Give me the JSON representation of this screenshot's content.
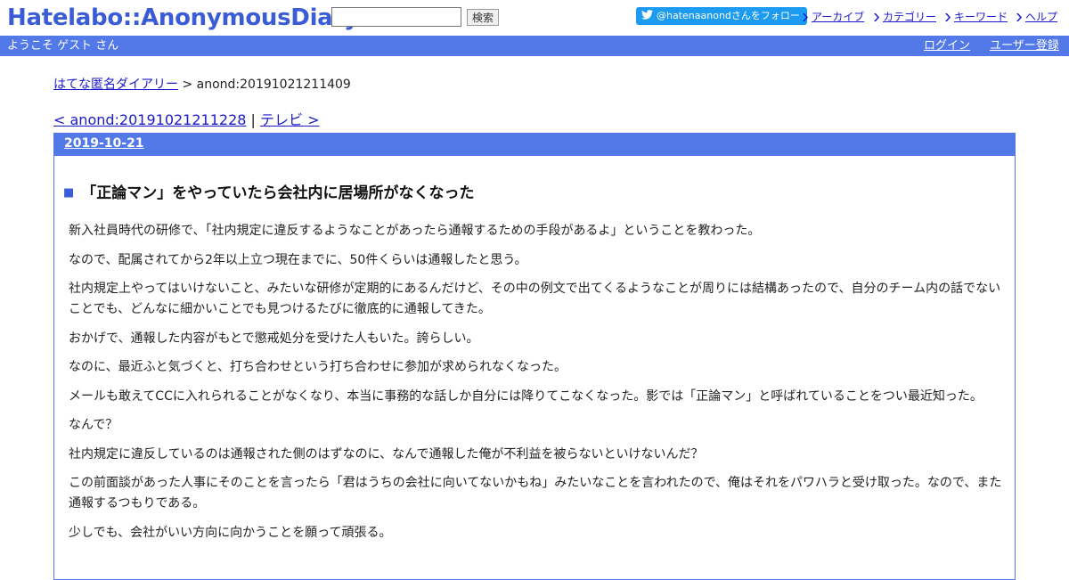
{
  "header": {
    "logo": "Hatelabo::AnonymousDiary",
    "search_button": "検索",
    "search_value": "",
    "twitter_follow": "@hatenaanondさんをフォロー",
    "nav": [
      "アーカイブ",
      "カテゴリー",
      "キーワード",
      "ヘルプ"
    ]
  },
  "topbar": {
    "welcome": "ようこそ ゲスト さん",
    "login": "ログイン",
    "signup": "ユーザー登録"
  },
  "breadcrumb": {
    "home": "はてな匿名ダイアリー",
    "separator": ">",
    "current": "anond:20191021211409"
  },
  "pager": {
    "prev": "< anond:20191021211228",
    "separator": "|",
    "next": "テレビ >"
  },
  "day": {
    "date": "2019-10-21"
  },
  "entry": {
    "marker": "■",
    "title": "「正論マン」をやっていたら会社内に居場所がなくなった",
    "paragraphs": [
      "新入社員時代の研修で、「社内規定に違反するようなことがあったら通報するための手段があるよ」ということを教わった。",
      "なので、配属されてから2年以上立つ現在までに、50件くらいは通報したと思う。",
      "社内規定上やってはいけないこと、みたいな研修が定期的にあるんだけど、その中の例文で出てくるようなことが周りには結構あったので、自分のチーム内の話でないことでも、どんなに細かいことでも見つけるたびに徹底的に通報してきた。",
      "おかげで、通報した内容がもとで懲戒処分を受けた人もいた。誇らしい。",
      "なのに、最近ふと気づくと、打ち合わせという打ち合わせに参加が求められなくなった。",
      "メールも敢えてCCに入れられることがなくなり、本当に事務的な話しか自分には降りてこなくなった。影では「正論マン」と呼ばれていることをつい最近知った。",
      "なんで？",
      "社内規定に違反しているのは通報された側のはずなのに、なんで通報した俺が不利益を被らないといけないんだ？",
      "この前面談があった人事にそのことを言ったら「君はうちの会社に向いてないかもね」みたいなことを言われたので、俺はそれをパワハラと受け取った。なので、また通報するつもりである。",
      "少しでも、会社がいい方向に向かうことを願って頑張る。"
    ]
  },
  "colors": {
    "accent": "#5279e7",
    "logo": "#3a5cd6",
    "twitter": "#1d9bf0",
    "link": "#1a1acc"
  }
}
